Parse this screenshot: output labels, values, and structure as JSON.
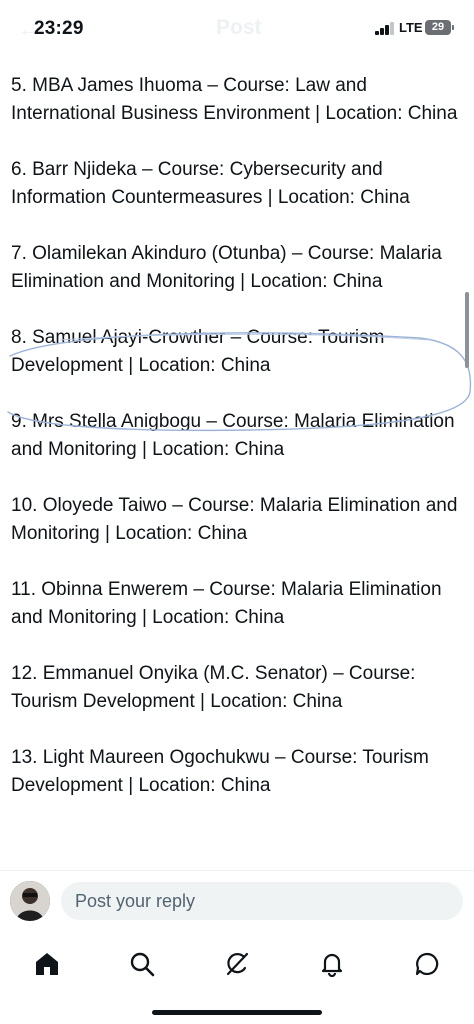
{
  "status_bar": {
    "time": "23:29",
    "network": "LTE",
    "battery": "29",
    "header_title": "Post",
    "back_glyph": "←"
  },
  "thread": {
    "items": [
      "5. MBA James Ihuoma – Course: Law and International Business Environment | Location: China",
      "6. Barr Njideka – Course: Cybersecurity and Information Countermeasures | Location: China",
      "7. Olamilekan Akinduro (Otunba) – Course: Malaria Elimination and Monitoring | Location: China",
      "8. Samuel Ajayi-Crowther – Course: Tourism Development | Location: China",
      "9. Mrs Stella Anigbogu – Course: Malaria Elimination and Monitoring | Location: China",
      "10. Oloyede Taiwo – Course: Malaria Elimination and Monitoring | Location: China",
      "11. Obinna Enwerem – Course: Malaria Elimination and Monitoring | Location: China",
      "12. Emmanuel Onyika (M.C. Senator) – Course: Tourism Development | Location: China",
      "13. Light Maureen Ogochukwu – Course: Tourism Development | Location: China"
    ]
  },
  "reply": {
    "placeholder": "Post your reply"
  },
  "tabs": [
    {
      "icon": "home-icon"
    },
    {
      "icon": "search-icon"
    },
    {
      "icon": "grok-icon"
    },
    {
      "icon": "bell-icon"
    },
    {
      "icon": "messages-icon"
    }
  ],
  "colors": {
    "text": "#0f1419",
    "muted": "#536471",
    "input_bg": "#eff3f4",
    "ink_circle": "#9db4d8"
  }
}
